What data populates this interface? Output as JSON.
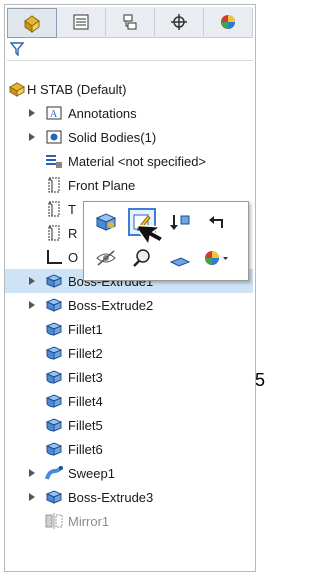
{
  "tabs": [
    {
      "icon": "feature-manager-icon"
    },
    {
      "icon": "property-manager-icon"
    },
    {
      "icon": "configuration-manager-icon"
    },
    {
      "icon": "dimxpert-icon"
    },
    {
      "icon": "display-manager-icon"
    }
  ],
  "filter": {
    "icon": "filter-icon"
  },
  "tree": {
    "root": "H STAB  (Default)",
    "annotations": "Annotations",
    "solid_bodies": "Solid Bodies(1)",
    "material": "Material <not specified>",
    "front_plane": "Front Plane",
    "top_plane_partial": "T",
    "right_plane_partial": "R",
    "origin_partial": "O",
    "boss_extrude1": "Boss-Extrude1",
    "boss_extrude2": "Boss-Extrude2",
    "fillet1": "Fillet1",
    "fillet2": "Fillet2",
    "fillet3": "Fillet3",
    "fillet4": "Fillet4",
    "fillet5": "Fillet5",
    "fillet6": "Fillet6",
    "sweep1": "Sweep1",
    "boss_extrude3": "Boss-Extrude3",
    "mirror1": "Mirror1"
  },
  "edge_text": "5",
  "colors": {
    "selection": "#cfe3f7",
    "accent": "#3a7fd1",
    "feature_gold": "#e8b631"
  }
}
